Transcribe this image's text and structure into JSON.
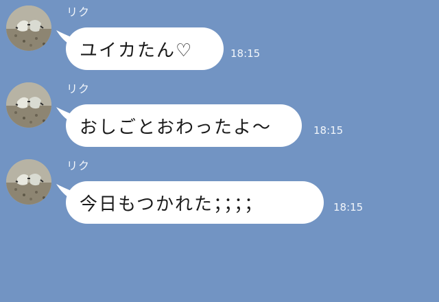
{
  "theme": {
    "background": "#7294c3",
    "bubble_color": "#ffffff",
    "meta_text_color": "#f2f6fb"
  },
  "messages": [
    {
      "sender": "リク",
      "text": "ユイカたん♡",
      "time": "18:15",
      "avatar_icon": "avatar-photo-icon"
    },
    {
      "sender": "リク",
      "text": "おしごとおわったよ〜",
      "time": "18:15",
      "avatar_icon": "avatar-photo-icon"
    },
    {
      "sender": "リク",
      "text": "今日もつかれた；；；；",
      "time": "18:15",
      "avatar_icon": "avatar-photo-icon"
    }
  ]
}
